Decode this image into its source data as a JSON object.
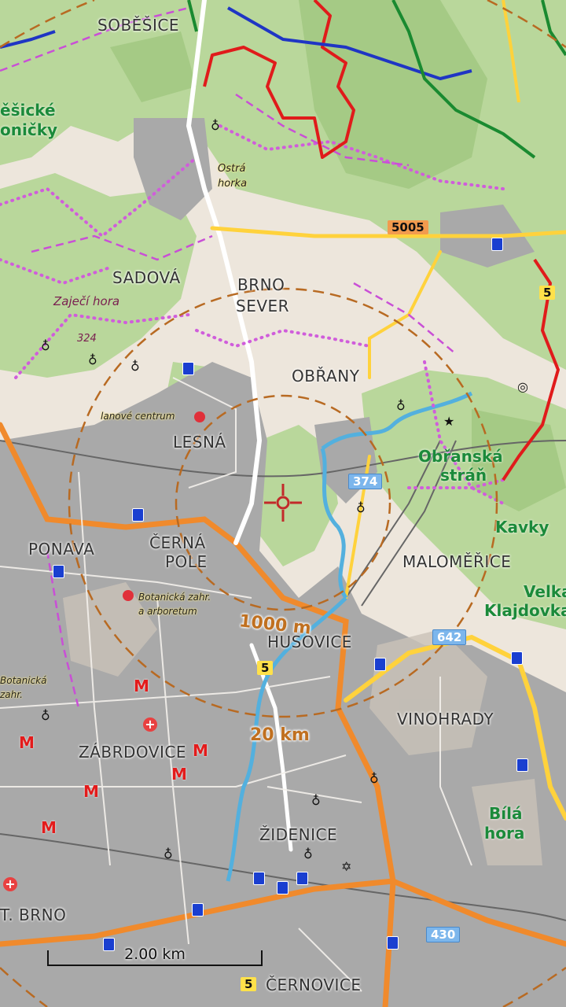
{
  "map": {
    "districts": [
      "SOBĚŠICE",
      "SADOVÁ",
      "BRNO",
      "SEVER",
      "OBŘANY",
      "LESNÁ",
      "PONAVA",
      "ČERNÁ",
      "POLE",
      "MALOMĚŘICE",
      "HUSOVICE",
      "VINOHRADY",
      "ZÁBRDOVICE",
      "ŽIDENICE",
      "ČERNOVICE",
      "T. BRNO"
    ],
    "green_areas": [
      "ěšické",
      "oničky",
      "Obřanská",
      "stráň",
      "Kavky",
      "Velká",
      "Klajdovka",
      "Bílá",
      "hora"
    ],
    "hills": [
      "Zaječí hora",
      "Ostrá",
      "horka"
    ],
    "elevation": "324",
    "pois": [
      "lanové centrum",
      "Botanická zahr.",
      "a arboretum",
      "Botanická",
      "zahr."
    ],
    "roads": [
      "5005",
      "374",
      "642",
      "430",
      "5",
      "5",
      "5"
    ],
    "distance_labels": {
      "inner": "1000 m",
      "outer": "20 km"
    },
    "scale": {
      "label": "2.00 km"
    },
    "colors": {
      "land": "#ede6dc",
      "forest": "#b9d79b",
      "urban": "#a9a9a9",
      "major_road": "#f08a2c",
      "river": "#53b0de",
      "trail": "#c94fd6",
      "red_trail": "#e01b1b",
      "range_circle": "#b86a22"
    }
  }
}
